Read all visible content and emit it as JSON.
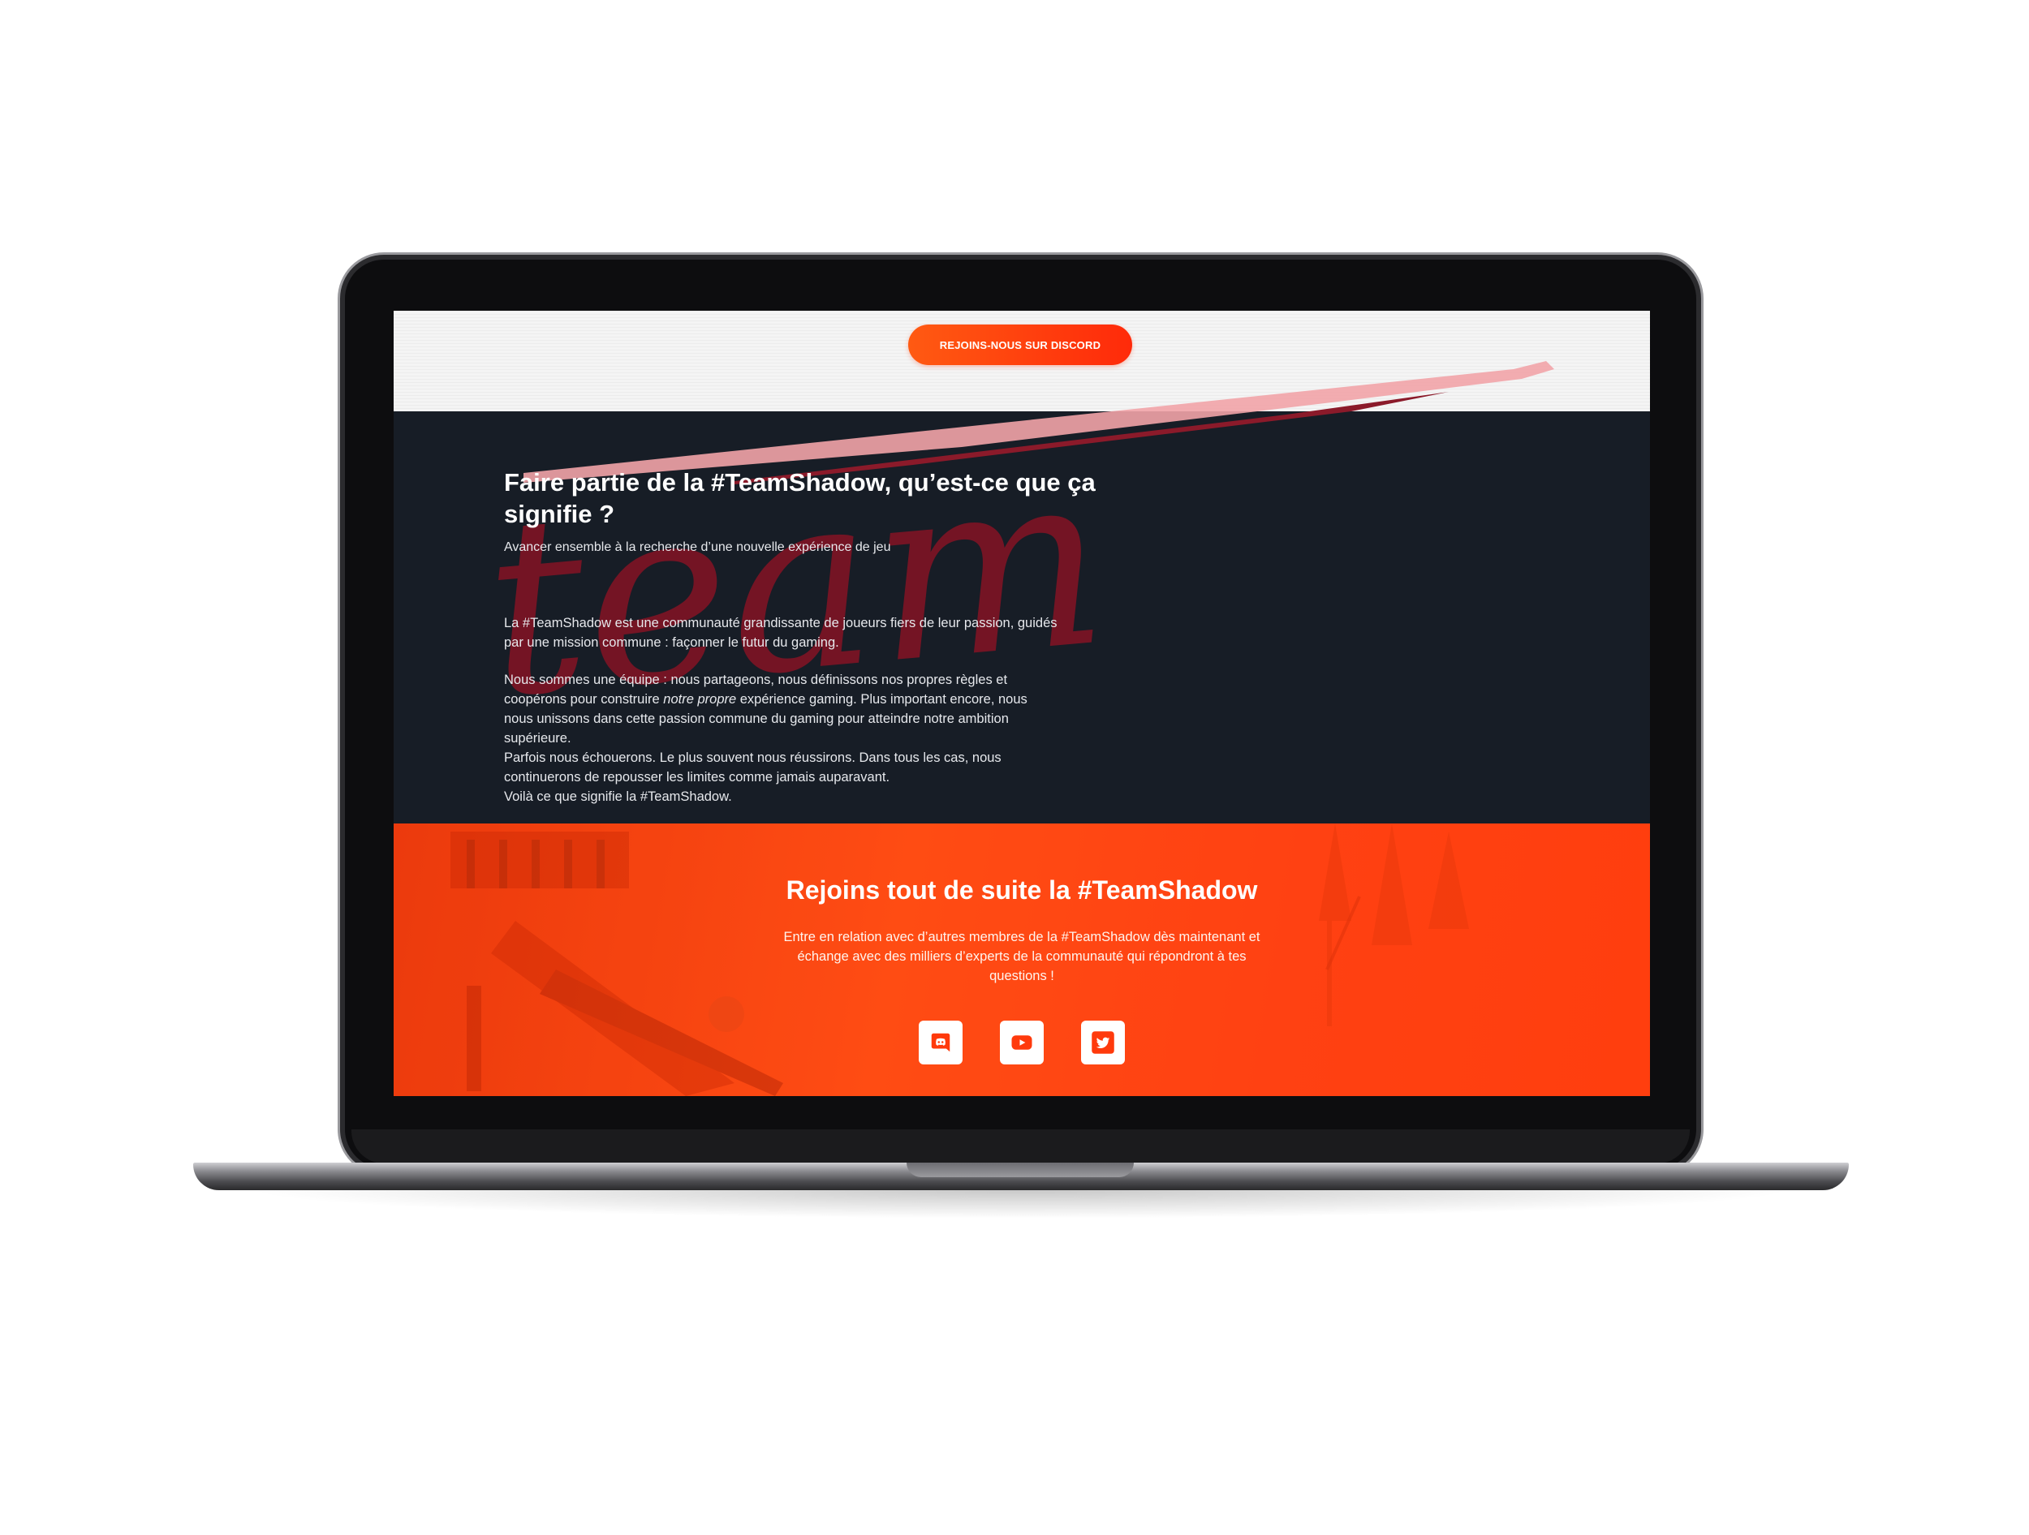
{
  "header": {
    "discord_button": "REJOINS-NOUS SUR DISCORD"
  },
  "about": {
    "title": "Faire partie de la #TeamShadow, qu’est-ce que ça signifie ?",
    "subtitle": "Avancer ensemble à la recherche d’une nouvelle expérience de jeu",
    "watermark": "team",
    "p1_line1": "La #TeamShadow est une communauté grandissante de joueurs fiers de leur passion, guidés",
    "p1_line2": "par une mission commune : façonner le futur du gaming.",
    "p2_line1": "Nous sommes une équipe : nous partageons, nous définissons nos propres règles et",
    "p2_line2_a": "coopérons pour construire ",
    "p2_line2_em": "notre propre",
    "p2_line2_b": " expérience gaming. Plus important encore, nous",
    "p2_line3": "nous unissons dans cette passion commune  du gaming pour atteindre notre ambition",
    "p2_line4": "supérieure.",
    "p2_line5": "Parfois nous échouerons. Le plus souvent nous réussirons. Dans tous les cas, nous",
    "p2_line6": "continuerons de repousser les limites comme jamais auparavant.",
    "p2_line7": "Voilà ce que signifie la #TeamShadow."
  },
  "join": {
    "title": "Rejoins tout de suite la #TeamShadow",
    "text_line1": "Entre en relation avec d’autres membres de la #TeamShadow dès maintenant et",
    "text_line2": "échange avec des milliers d’experts de la communauté qui répondront à tes",
    "text_line3": "questions !",
    "socials": [
      {
        "icon": "discord-icon"
      },
      {
        "icon": "youtube-icon"
      },
      {
        "icon": "twitter-icon"
      }
    ]
  },
  "colors": {
    "accent": "#ff3a0c",
    "dark_bg": "#171d26",
    "watermark": "#7a1424"
  }
}
